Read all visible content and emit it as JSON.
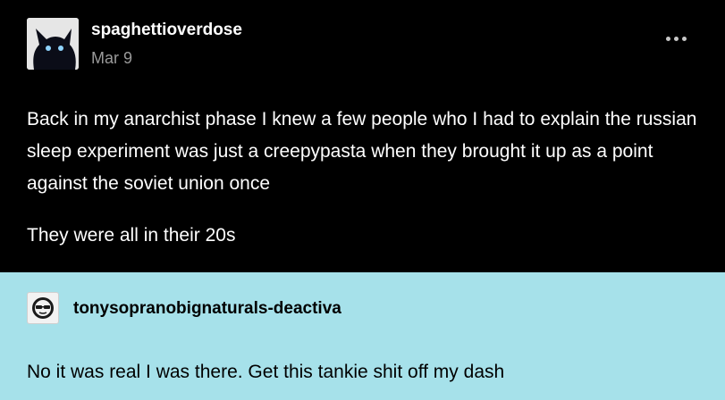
{
  "original_post": {
    "username": "spaghettioverdose",
    "date": "Mar 9",
    "avatar_icon": "black-cat-avatar-icon",
    "more_icon": "more-options-icon",
    "paragraphs": [
      "Back in my anarchist phase I knew a few people who I had to explain the russian sleep experiment was just a creepypasta when they brought it up as a point against the soviet union once",
      "They were all in their 20s"
    ]
  },
  "reblog": {
    "username": "tonysopranobignaturals-deactiva",
    "avatar_icon": "sunglasses-face-avatar-icon",
    "text": "No it was real I was there. Get this tankie shit off my dash",
    "background": "#a6e1ea"
  }
}
